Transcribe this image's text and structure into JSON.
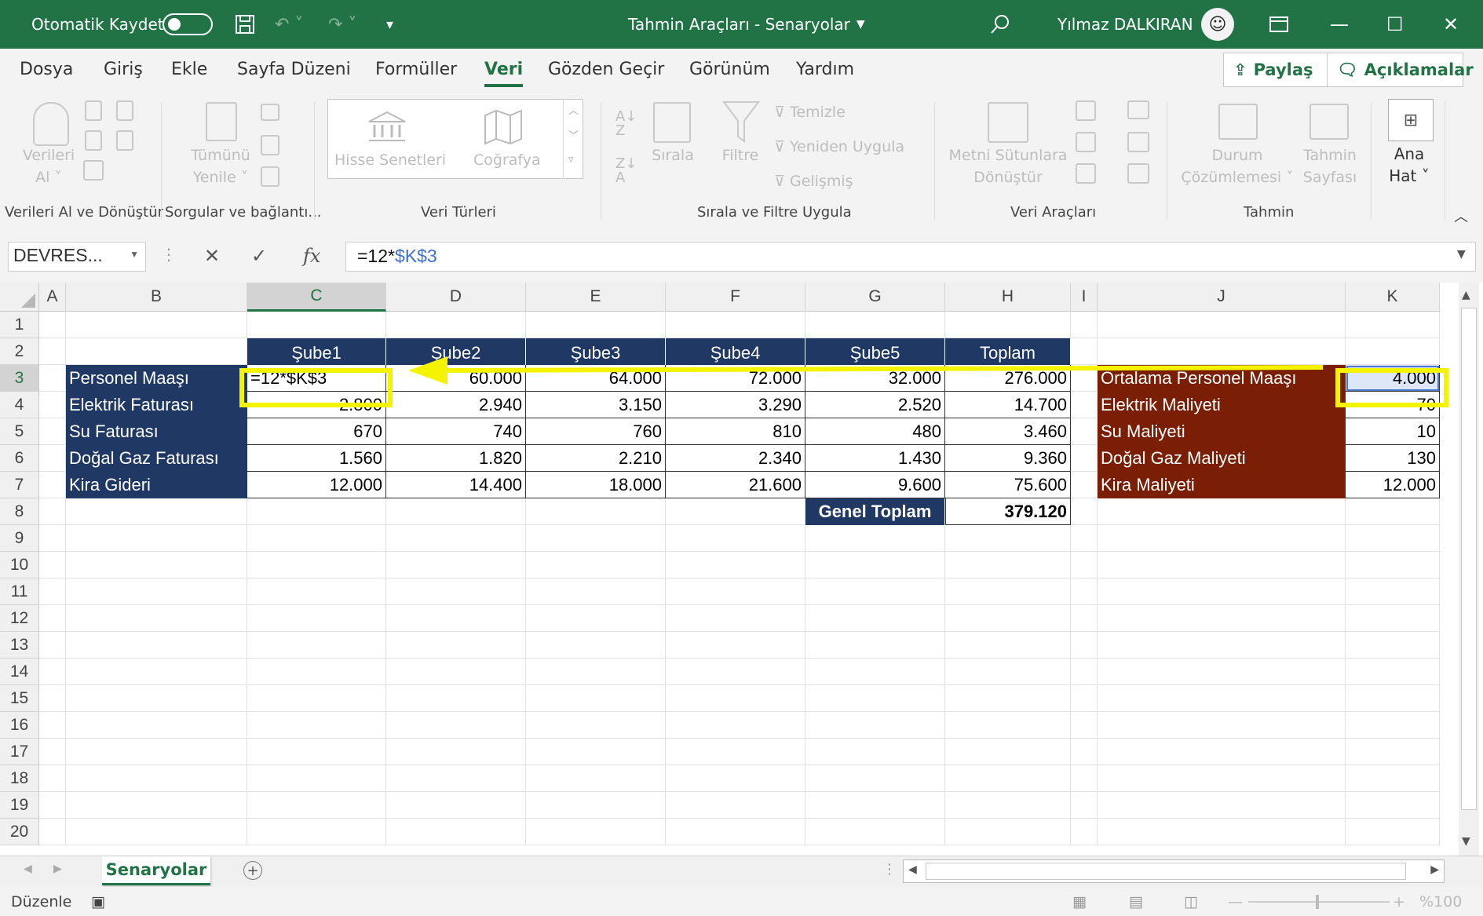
{
  "titlebar": {
    "autosave_label": "Otomatik Kaydet",
    "doc_title": "Tahmin Araçları - Senaryolar",
    "user_name": "Yılmaz DALKIRAN"
  },
  "tabs": [
    "Dosya",
    "Giriş",
    "Ekle",
    "Sayfa Düzeni",
    "Formüller",
    "Veri",
    "Gözden Geçir",
    "Görünüm",
    "Yardım"
  ],
  "active_tab": "Veri",
  "share_label": "Paylaş",
  "comments_label": "Açıklamalar",
  "ribbon": {
    "get_data_1": "Verileri",
    "get_data_2": "Al",
    "refresh_1": "Tümünü",
    "refresh_2": "Yenile",
    "stocks": "Hisse Senetleri",
    "geography": "Coğrafya",
    "sort": "Sırala",
    "filter": "Filtre",
    "clear": "Temizle",
    "reapply": "Yeniden Uygula",
    "advanced": "Gelişmiş",
    "text_to_columns_1": "Metni Sütunlara",
    "text_to_columns_2": "Dönüştür",
    "whatif_1": "Durum",
    "whatif_2": "Çözümlemesi",
    "forecast_1": "Tahmin",
    "forecast_2": "Sayfası",
    "outline_1": "Ana",
    "outline_2": "Hat",
    "groups": {
      "get_transform": "Verileri Al ve Dönüştür",
      "queries": "Sorgular ve bağlantı...",
      "data_types": "Veri Türleri",
      "sort_filter": "Sırala ve Filtre Uygula",
      "data_tools": "Veri Araçları",
      "forecast": "Tahmin"
    }
  },
  "formula_bar": {
    "name_box": "DEVRES...",
    "formula_prefix": "=12*",
    "formula_ref": "$K$3"
  },
  "columns": [
    "A",
    "B",
    "C",
    "D",
    "E",
    "F",
    "G",
    "H",
    "I",
    "J",
    "K"
  ],
  "rows": [
    "1",
    "2",
    "3",
    "4",
    "5",
    "6",
    "7",
    "8",
    "9",
    "10",
    "11",
    "12",
    "13",
    "14",
    "15",
    "16",
    "17",
    "18",
    "19",
    "20"
  ],
  "table": {
    "headers": [
      "Şube1",
      "Şube2",
      "Şube3",
      "Şube4",
      "Şube5",
      "Toplam"
    ],
    "rows": [
      {
        "label": "Personel Maaşı",
        "values": [
          "=12*$K$3",
          "60.000",
          "64.000",
          "72.000",
          "32.000",
          "276.000"
        ]
      },
      {
        "label": "Elektrik Faturası",
        "values": [
          "2.800",
          "2.940",
          "3.150",
          "3.290",
          "2.520",
          "14.700"
        ]
      },
      {
        "label": "Su Faturası",
        "values": [
          "670",
          "740",
          "760",
          "810",
          "480",
          "3.460"
        ]
      },
      {
        "label": "Doğal Gaz Faturası",
        "values": [
          "1.560",
          "1.820",
          "2.210",
          "2.340",
          "1.430",
          "9.360"
        ]
      },
      {
        "label": "Kira Gideri",
        "values": [
          "12.000",
          "14.400",
          "18.000",
          "21.600",
          "9.600",
          "75.600"
        ]
      }
    ],
    "grand_total_label": "Genel Toplam",
    "grand_total_value": "379.120"
  },
  "side_table": [
    {
      "label": "Ortalama Personel Maaşı",
      "value": "4.000"
    },
    {
      "label": "Elektrik Maliyeti",
      "value": "70"
    },
    {
      "label": "Su Maliyeti",
      "value": "10"
    },
    {
      "label": "Doğal Gaz Maliyeti",
      "value": "130"
    },
    {
      "label": "Kira Maliyeti",
      "value": "12.000"
    }
  ],
  "sheet_tab": "Senaryolar",
  "status": {
    "mode": "Düzenle",
    "zoom": "%100"
  },
  "colors": {
    "excel_green": "#217346",
    "header_blue": "#1f3864",
    "label_red": "#7b1e06",
    "highlight_yellow": "#f4f400"
  }
}
